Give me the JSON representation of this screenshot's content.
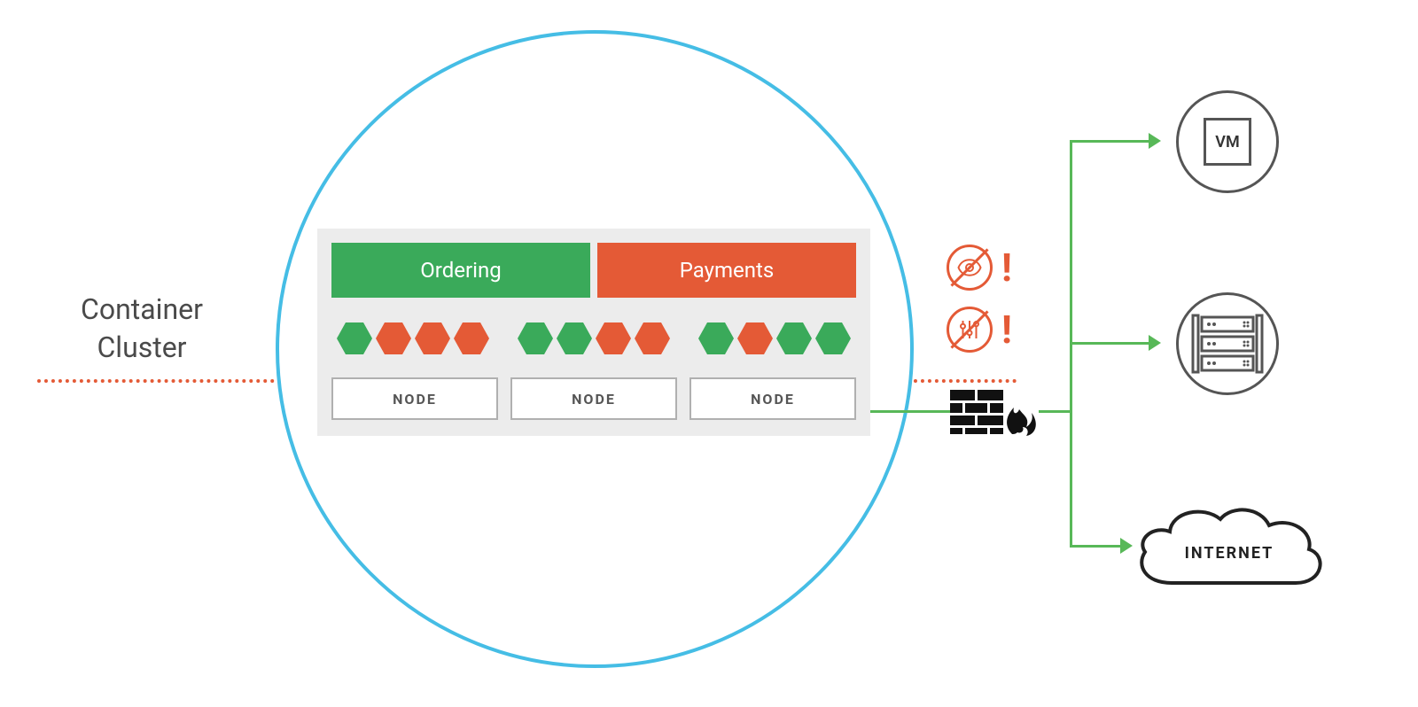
{
  "label": {
    "line1": "Container",
    "line2": "Cluster"
  },
  "services": {
    "ordering": "Ordering",
    "payments": "Payments"
  },
  "hexagons": [
    "green",
    "orange",
    "orange",
    "orange",
    "gap",
    "green",
    "green",
    "orange",
    "orange",
    "gap",
    "green",
    "orange",
    "green",
    "green"
  ],
  "nodes": [
    "NODE",
    "NODE",
    "NODE"
  ],
  "targets": {
    "vm": "VM",
    "internet": "INTERNET"
  },
  "colors": {
    "green": "#3aaa5a",
    "orange": "#e45a36",
    "blue": "#45bde5",
    "arrowGreen": "#58b858"
  },
  "warnings": {
    "icon1": "eye-icon",
    "icon2": "sliders-icon"
  }
}
